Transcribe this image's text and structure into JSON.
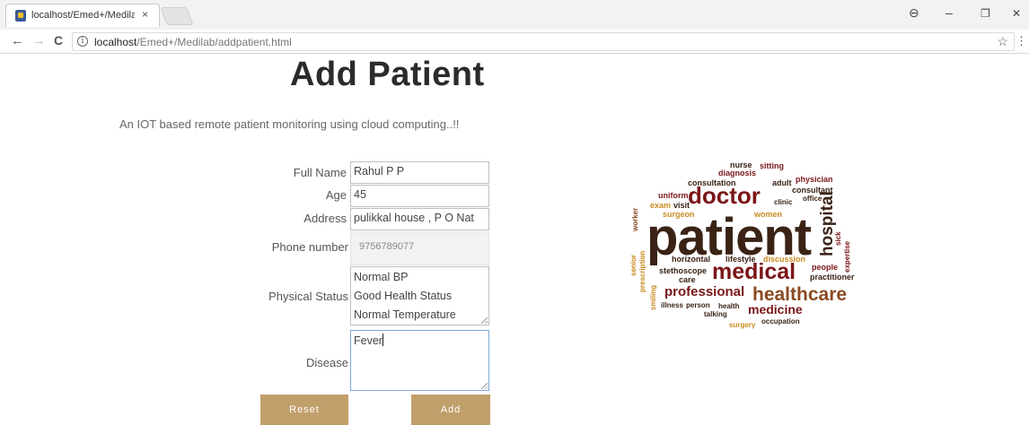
{
  "browser": {
    "tab_title": "localhost/Emed+/Medila",
    "tab_close": "×",
    "url_host": "localhost",
    "url_path": "/Emed+/Medilab/addpatient.html",
    "back": "←",
    "forward": "→",
    "reload": "C",
    "info": "i",
    "star": "☆",
    "menu": "⋮",
    "account": "⊖",
    "minimize": "–",
    "restore": "❐",
    "close": "✕"
  },
  "page": {
    "title": "Add Patient",
    "subtitle": "An IOT based remote patient monitoring using cloud computing..!!"
  },
  "form": {
    "full_name_label": "Full Name",
    "full_name_value": "Rahul P P",
    "age_label": "Age",
    "age_value": "45",
    "address_label": "Address",
    "address_value": "pulikkal house , P O Nat",
    "phone_label": "Phone number",
    "phone_value": "9756789077",
    "physical_label": "Physical Status",
    "physical_lines": [
      "Normal BP",
      "Good Health Status",
      "Normal Temperature"
    ],
    "disease_label": "Disease",
    "disease_value": "Fever",
    "reset_label": "Reset",
    "add_label": "Add"
  },
  "word_cloud": {
    "colors": {
      "dark": "#3a2315",
      "red": "#7a1618",
      "brown": "#8a4a22",
      "orange": "#c98a1f"
    },
    "words": [
      "nurse",
      "sitting",
      "diagnosis",
      "consultation",
      "adult",
      "physician",
      "consultant",
      "uniform",
      "doctor",
      "clinic",
      "office",
      "exam",
      "visit",
      "surgeon",
      "women",
      "worker",
      "patient",
      "hospital",
      "sick",
      "expertise",
      "senior",
      "prescription",
      "horizontal",
      "lifestyle",
      "discussion",
      "people",
      "stethoscope",
      "medical",
      "practitioner",
      "care",
      "smiling",
      "professional",
      "healthcare",
      "illness",
      "person",
      "health",
      "medicine",
      "talking",
      "occupation",
      "surgery"
    ]
  }
}
